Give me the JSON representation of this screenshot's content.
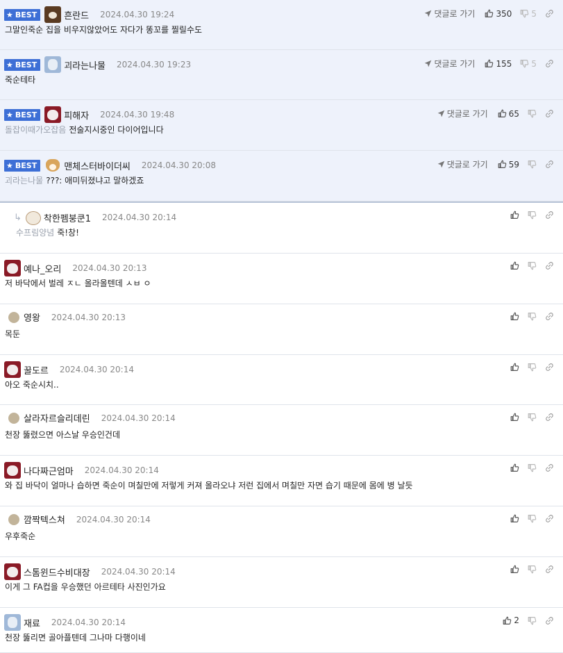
{
  "comments": [
    {
      "best": true,
      "badge": "BEST",
      "avatar": "bear",
      "nick": "흔란드",
      "date": "2024.04.30 19:24",
      "prefix": "",
      "text": "그말인죽순 집을 비우지않았어도 자다가 똥꼬를 찔릴수도",
      "goto": "댓글로 가기",
      "likes": "350",
      "dislikes": "5"
    },
    {
      "best": true,
      "badge": "BEST",
      "avatar": "blue",
      "nick": "괴라는나물",
      "date": "2024.04.30 19:23",
      "prefix": "",
      "text": "죽순테타",
      "goto": "댓글로 가기",
      "likes": "155",
      "dislikes": "5"
    },
    {
      "best": true,
      "badge": "BEST",
      "avatar": "dog",
      "nick": "피해자",
      "date": "2024.04.30 19:48",
      "prefix": "돌잡이때가오잡음",
      "text": "전술지시중인 다이어입니다",
      "goto": "댓글로 가기",
      "likes": "65",
      "dislikes": ""
    },
    {
      "best": true,
      "badge": "BEST",
      "avatar": "shiba",
      "nick": "맨체스터바이더씨",
      "date": "2024.04.30 20:08",
      "prefix": "괴라는나물",
      "text": "???: 애미뒤졌냐고 말하겠죠",
      "goto": "댓글로 가기",
      "likes": "59",
      "dislikes": ""
    },
    {
      "best": false,
      "reply": true,
      "avatar": "puppy",
      "nick": "착한펨붕쿤1",
      "date": "2024.04.30 20:14",
      "prefix": "수프림양념",
      "text": "죽!창!",
      "likes": "",
      "dislikes": ""
    },
    {
      "best": false,
      "avatar": "dog",
      "nick": "예나_오리",
      "date": "2024.04.30 20:13",
      "prefix": "",
      "text": "저 바닥에서 벌레 ㅈㄴ 올라올텐데 ㅅㅂ ㅇ",
      "likes": "",
      "dislikes": ""
    },
    {
      "best": false,
      "avatar": "dot",
      "nick": "영왕",
      "date": "2024.04.30 20:13",
      "prefix": "",
      "text": "목둔",
      "likes": "",
      "dislikes": ""
    },
    {
      "best": false,
      "avatar": "dog",
      "nick": "꿀도르",
      "date": "2024.04.30 20:14",
      "prefix": "",
      "text": "아오 죽순시치..",
      "likes": "",
      "dislikes": ""
    },
    {
      "best": false,
      "avatar": "dot",
      "nick": "살라자르슬리데린",
      "date": "2024.04.30 20:14",
      "prefix": "",
      "text": "천장 뚫렸으면 아스날 우승인건데",
      "likes": "",
      "dislikes": ""
    },
    {
      "best": false,
      "avatar": "dog",
      "nick": "나다짜근엄마",
      "date": "2024.04.30 20:14",
      "prefix": "",
      "text": "와 집 바닥이 얼마나 습하면 죽순이 며칠만에 저렇게 커져 올라오냐 저런 집에서 며칠만 자면 습기 때문에 몸에 병 날듯",
      "likes": "",
      "dislikes": ""
    },
    {
      "best": false,
      "avatar": "dot",
      "nick": "깜짝텍스쳐",
      "date": "2024.04.30 20:14",
      "prefix": "",
      "text": "우후죽순",
      "likes": "",
      "dislikes": ""
    },
    {
      "best": false,
      "avatar": "dog",
      "nick": "스톰윈드수비대장",
      "date": "2024.04.30 20:14",
      "prefix": "",
      "text": "이게 그 FA컵을 우승했던 아르테타 사진인가요",
      "likes": "",
      "dislikes": ""
    },
    {
      "best": false,
      "avatar": "blue",
      "nick": "재료",
      "date": "2024.04.30 20:14",
      "prefix": "",
      "text": "천장 뚫리면 골아플텐데 그나마 다행이네",
      "likes": "2",
      "dislikes": ""
    }
  ],
  "colors": {
    "best_bg": "#eef2fb",
    "badge": "#3d6fd6",
    "border": "#dfe3ea"
  },
  "icons": {
    "thumbs_up": "thumbs-up-icon",
    "thumbs_down": "thumbs-down-icon",
    "link": "link-icon",
    "send": "send-arrow-icon",
    "reply": "reply-arrow-icon",
    "star": "star-icon"
  }
}
